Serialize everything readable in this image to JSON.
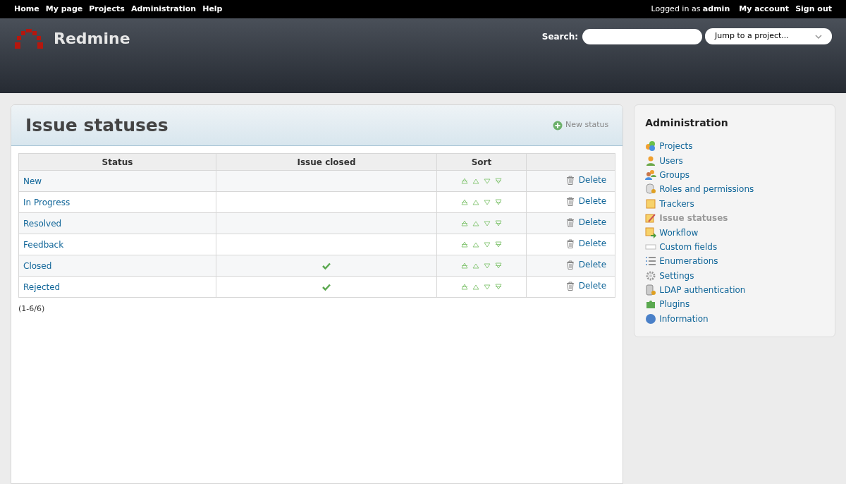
{
  "top_menu": {
    "left": [
      "Home",
      "My page",
      "Projects",
      "Administration",
      "Help"
    ],
    "logged_in_prefix": "Logged in as",
    "logged_in_user": "admin",
    "right": [
      "My account",
      "Sign out"
    ]
  },
  "header": {
    "title": "Redmine",
    "search_label": "Search:",
    "jump": "Jump to a project..."
  },
  "content": {
    "title": "Issue statuses",
    "new_link": "New status",
    "table": {
      "columns": [
        "Status",
        "Issue closed",
        "Sort",
        ""
      ],
      "rows": [
        {
          "status": "New",
          "closed": false,
          "action": "Delete"
        },
        {
          "status": "In Progress",
          "closed": false,
          "action": "Delete"
        },
        {
          "status": "Resolved",
          "closed": false,
          "action": "Delete"
        },
        {
          "status": "Feedback",
          "closed": false,
          "action": "Delete"
        },
        {
          "status": "Closed",
          "closed": true,
          "action": "Delete"
        },
        {
          "status": "Rejected",
          "closed": true,
          "action": "Delete"
        }
      ]
    },
    "pagination": "(1-6/6)"
  },
  "sidebar": {
    "title": "Administration",
    "items": [
      {
        "label": "Projects",
        "selected": false
      },
      {
        "label": "Users",
        "selected": false
      },
      {
        "label": "Groups",
        "selected": false
      },
      {
        "label": "Roles and permissions",
        "selected": false
      },
      {
        "label": "Trackers",
        "selected": false
      },
      {
        "label": "Issue statuses",
        "selected": true
      },
      {
        "label": "Workflow",
        "selected": false
      },
      {
        "label": "Custom fields",
        "selected": false
      },
      {
        "label": "Enumerations",
        "selected": false
      },
      {
        "label": "Settings",
        "selected": false
      },
      {
        "label": "LDAP authentication",
        "selected": false
      },
      {
        "label": "Plugins",
        "selected": false
      },
      {
        "label": "Information",
        "selected": false
      }
    ]
  }
}
